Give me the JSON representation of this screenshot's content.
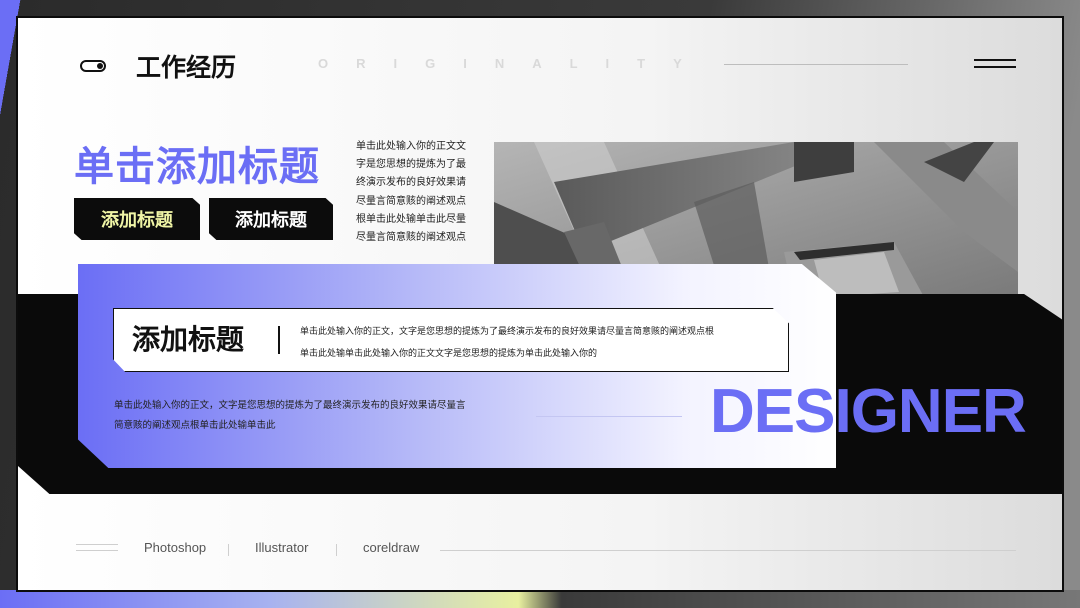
{
  "header": {
    "title": "工作经历",
    "watermark": "ORIGINALITY"
  },
  "hero": {
    "title": "单击添加标题",
    "tags": [
      "添加标题",
      "添加标题"
    ],
    "side_text": "单击此处输入你的正文文字是您思想的提炼为了最终演示发布的良好效果请尽量言简意赅的阐述观点根单击此处输单击此尽量尽量言简意赅的阐述观点"
  },
  "card": {
    "inner_title": "添加标题",
    "inner_text_line1": "单击此处输入你的正文，文字是您思想的提炼为了最终演示发布的良好效果请尽量言简意赅的阐述观点根",
    "inner_text_line2": "单击此处输单击此处输入你的正文文字是您思想的提炼为单击此处输入你的",
    "body_text": "单击此处输入你的正文，文字是您思想的提炼为了最终演示发布的良好效果请尽量言简意赅的阐述观点根单击此处输单击此",
    "highlight": "DESIGNER"
  },
  "footer": {
    "skills": [
      "Photoshop",
      "Illustrator",
      "coreldraw"
    ]
  },
  "colors": {
    "accent": "#6b6ef5",
    "tag_highlight": "#f0f5a6",
    "dark": "#0a0a0a"
  },
  "icons": {
    "toggle": "toggle-icon",
    "menu": "menu-icon"
  }
}
